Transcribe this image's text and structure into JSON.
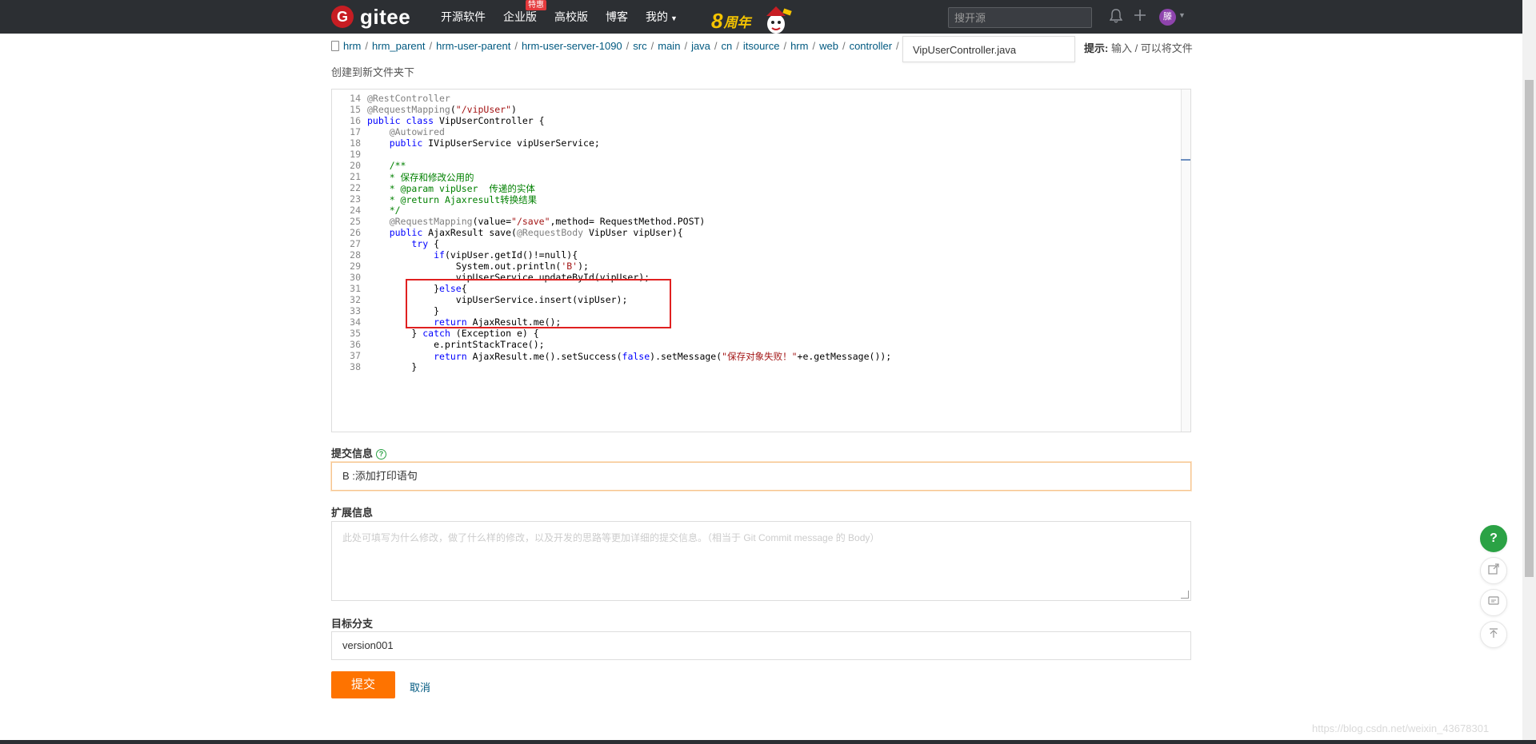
{
  "nav": {
    "logo_text": "gitee",
    "items": [
      "开源软件",
      "企业版",
      "高校版",
      "博客",
      "我的"
    ],
    "enterprise_badge": "特惠",
    "anniversary_number": "8",
    "anniversary_text": "周年",
    "search_placeholder": "搜开源",
    "avatar_text": "滕"
  },
  "breadcrumb": {
    "parts": [
      "hrm",
      "hrm_parent",
      "hrm-user-parent",
      "hrm-user-server-1090",
      "src",
      "main",
      "java",
      "cn",
      "itsource",
      "hrm",
      "web",
      "controller"
    ],
    "trailing_separator": "/",
    "filename": "VipUserController.java",
    "hint_label": "提示:",
    "hint_text": " 输入 / 可以将文件",
    "hint_cont": "创建到新文件夹下"
  },
  "editor": {
    "line_numbers": [
      "14",
      "15",
      "16",
      "17",
      "18",
      "19",
      "20",
      "21",
      "22",
      "23",
      "24",
      "25",
      "26",
      "27",
      "28",
      "29",
      "30",
      "31",
      "32",
      "33",
      "34",
      "35",
      "36",
      "37",
      "38"
    ]
  },
  "form": {
    "commit_label": "提交信息",
    "commit_value": "B :添加打印语句",
    "extended_label": "扩展信息",
    "extended_placeholder": "此处可填写为什么修改，做了什么样的修改，以及开发的思路等更加详细的提交信息。（相当于 Git Commit message 的 Body）",
    "branch_label": "目标分支",
    "branch_value": "version001",
    "submit_label": "提交",
    "cancel_label": "取消"
  },
  "watermark": "https://blog.csdn.net/weixin_43678301",
  "colors": {
    "topbar": "#2c2f33",
    "brand_red": "#c71d23",
    "submit_orange": "#fe7300",
    "help_green": "#2ba245",
    "highlight_red": "#e02020"
  },
  "icons": [
    "bell-icon",
    "plus-icon",
    "help-icon",
    "share-icon",
    "comment-icon",
    "back-to-top-icon",
    "file-icon"
  ]
}
